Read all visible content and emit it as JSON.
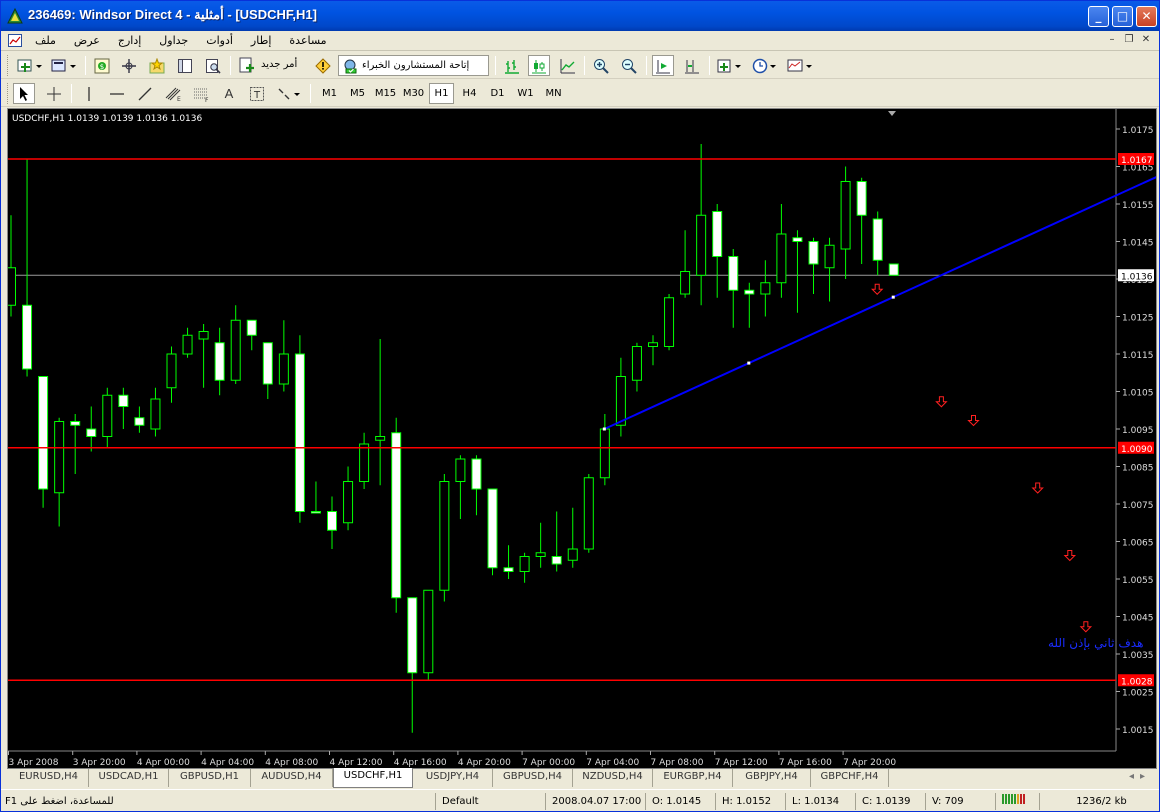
{
  "window": {
    "title": "236469: Windsor Direct 4 - أمثلية - [USDCHF,H1]"
  },
  "menu": [
    "ملف",
    "عرض",
    "إدارج",
    "جداول",
    "أدوات",
    "إطار",
    "مساعدة"
  ],
  "toolbar": {
    "new_order_label": "أمر جديد",
    "experts_label": "إتاحة المستشارون الخبراء",
    "timeframes": [
      "M1",
      "M5",
      "M15",
      "M30",
      "H1",
      "H4",
      "D1",
      "W1",
      "MN"
    ],
    "active_timeframe": "H1"
  },
  "chart": {
    "info": "USDCHF,H1  1.0139 1.0139 1.0136 1.0136",
    "annotation": "هدف ثاني بإذن الله",
    "colors": {
      "bull": "#00ff00",
      "bear": "#00ff00",
      "body_bull": "#000000",
      "body_bear": "#ffffff",
      "level": "#ff0000",
      "trend": "#0000ff",
      "grid": "#888888"
    }
  },
  "chart_data": {
    "type": "candlestick",
    "symbol": "USDCHF",
    "timeframe": "H1",
    "ylim": [
      1.001,
      1.018
    ],
    "y_ticks": [
      1.0175,
      1.0165,
      1.0155,
      1.0145,
      1.0135,
      1.0125,
      1.0115,
      1.0105,
      1.0095,
      1.0085,
      1.0075,
      1.0065,
      1.0055,
      1.0045,
      1.0035,
      1.0025,
      1.0015
    ],
    "x_ticks": [
      {
        "label": "3 Apr 2008",
        "index": 0
      },
      {
        "label": "3 Apr 20:00",
        "index": 4
      },
      {
        "label": "4 Apr 00:00",
        "index": 8
      },
      {
        "label": "4 Apr 04:00",
        "index": 12
      },
      {
        "label": "4 Apr 08:00",
        "index": 16
      },
      {
        "label": "4 Apr 12:00",
        "index": 20
      },
      {
        "label": "4 Apr 16:00",
        "index": 24
      },
      {
        "label": "4 Apr 20:00",
        "index": 28
      },
      {
        "label": "7 Apr 00:00",
        "index": 32
      },
      {
        "label": "7 Apr 04:00",
        "index": 36
      },
      {
        "label": "7 Apr 08:00",
        "index": 40
      },
      {
        "label": "7 Apr 12:00",
        "index": 44
      },
      {
        "label": "7 Apr 16:00",
        "index": 48
      },
      {
        "label": "7 Apr 20:00",
        "index": 52
      }
    ],
    "candles": [
      {
        "o": 1.0128,
        "h": 1.0152,
        "l": 1.0125,
        "c": 1.0138
      },
      {
        "o": 1.0128,
        "h": 1.0167,
        "l": 1.0109,
        "c": 1.0111
      },
      {
        "o": 1.0109,
        "h": 1.0109,
        "l": 1.0074,
        "c": 1.0079
      },
      {
        "o": 1.0078,
        "h": 1.0098,
        "l": 1.0069,
        "c": 1.0097
      },
      {
        "o": 1.0097,
        "h": 1.0099,
        "l": 1.0083,
        "c": 1.0096
      },
      {
        "o": 1.0095,
        "h": 1.0101,
        "l": 1.0089,
        "c": 1.0093
      },
      {
        "o": 1.0093,
        "h": 1.0106,
        "l": 1.009,
        "c": 1.0104
      },
      {
        "o": 1.0104,
        "h": 1.0106,
        "l": 1.0095,
        "c": 1.0101
      },
      {
        "o": 1.0098,
        "h": 1.0101,
        "l": 1.0094,
        "c": 1.0096
      },
      {
        "o": 1.0095,
        "h": 1.0106,
        "l": 1.0093,
        "c": 1.0103
      },
      {
        "o": 1.0106,
        "h": 1.0117,
        "l": 1.0102,
        "c": 1.0115
      },
      {
        "o": 1.0115,
        "h": 1.0122,
        "l": 1.0114,
        "c": 1.012
      },
      {
        "o": 1.0119,
        "h": 1.0123,
        "l": 1.0106,
        "c": 1.0121
      },
      {
        "o": 1.0118,
        "h": 1.0122,
        "l": 1.0104,
        "c": 1.0108
      },
      {
        "o": 1.0108,
        "h": 1.0128,
        "l": 1.0107,
        "c": 1.0124
      },
      {
        "o": 1.0124,
        "h": 1.0124,
        "l": 1.0116,
        "c": 1.012
      },
      {
        "o": 1.0118,
        "h": 1.0118,
        "l": 1.0103,
        "c": 1.0107
      },
      {
        "o": 1.0107,
        "h": 1.0124,
        "l": 1.0105,
        "c": 1.0115
      },
      {
        "o": 1.0115,
        "h": 1.012,
        "l": 1.007,
        "c": 1.0073
      },
      {
        "o": 1.0073,
        "h": 1.0081,
        "l": 1.0073,
        "c": 1.0073
      },
      {
        "o": 1.0073,
        "h": 1.0077,
        "l": 1.0063,
        "c": 1.0068
      },
      {
        "o": 1.007,
        "h": 1.0085,
        "l": 1.0068,
        "c": 1.0081
      },
      {
        "o": 1.0081,
        "h": 1.0094,
        "l": 1.0079,
        "c": 1.0091
      },
      {
        "o": 1.0092,
        "h": 1.0119,
        "l": 1.008,
        "c": 1.0093
      },
      {
        "o": 1.0094,
        "h": 1.0098,
        "l": 1.0046,
        "c": 1.005
      },
      {
        "o": 1.005,
        "h": 1.005,
        "l": 1.0014,
        "c": 1.003
      },
      {
        "o": 1.003,
        "h": 1.0052,
        "l": 1.0028,
        "c": 1.0052
      },
      {
        "o": 1.0052,
        "h": 1.0083,
        "l": 1.0049,
        "c": 1.0081
      },
      {
        "o": 1.0081,
        "h": 1.0088,
        "l": 1.0071,
        "c": 1.0087
      },
      {
        "o": 1.0087,
        "h": 1.0088,
        "l": 1.0072,
        "c": 1.0079
      },
      {
        "o": 1.0079,
        "h": 1.0079,
        "l": 1.0056,
        "c": 1.0058
      },
      {
        "o": 1.0058,
        "h": 1.0064,
        "l": 1.0055,
        "c": 1.0057
      },
      {
        "o": 1.0057,
        "h": 1.0062,
        "l": 1.0054,
        "c": 1.0061
      },
      {
        "o": 1.0061,
        "h": 1.007,
        "l": 1.0058,
        "c": 1.0062
      },
      {
        "o": 1.0061,
        "h": 1.0073,
        "l": 1.0057,
        "c": 1.0059
      },
      {
        "o": 1.006,
        "h": 1.0074,
        "l": 1.0058,
        "c": 1.0063
      },
      {
        "o": 1.0063,
        "h": 1.0083,
        "l": 1.0062,
        "c": 1.0082
      },
      {
        "o": 1.0082,
        "h": 1.0099,
        "l": 1.008,
        "c": 1.0095
      },
      {
        "o": 1.0096,
        "h": 1.0114,
        "l": 1.0093,
        "c": 1.0109
      },
      {
        "o": 1.0108,
        "h": 1.0118,
        "l": 1.0105,
        "c": 1.0117
      },
      {
        "o": 1.0117,
        "h": 1.012,
        "l": 1.0112,
        "c": 1.0118
      },
      {
        "o": 1.0117,
        "h": 1.0131,
        "l": 1.0116,
        "c": 1.013
      },
      {
        "o": 1.0131,
        "h": 1.0148,
        "l": 1.013,
        "c": 1.0137
      },
      {
        "o": 1.0136,
        "h": 1.0171,
        "l": 1.0128,
        "c": 1.0152
      },
      {
        "o": 1.0153,
        "h": 1.0155,
        "l": 1.013,
        "c": 1.0141
      },
      {
        "o": 1.0141,
        "h": 1.0143,
        "l": 1.0122,
        "c": 1.0132
      },
      {
        "o": 1.0132,
        "h": 1.0134,
        "l": 1.0122,
        "c": 1.0131
      },
      {
        "o": 1.0131,
        "h": 1.014,
        "l": 1.0125,
        "c": 1.0134
      },
      {
        "o": 1.0134,
        "h": 1.0155,
        "l": 1.013,
        "c": 1.0147
      },
      {
        "o": 1.0146,
        "h": 1.0148,
        "l": 1.0126,
        "c": 1.0145
      },
      {
        "o": 1.0145,
        "h": 1.0146,
        "l": 1.0131,
        "c": 1.0139
      },
      {
        "o": 1.0138,
        "h": 1.0146,
        "l": 1.0129,
        "c": 1.0144
      },
      {
        "o": 1.0143,
        "h": 1.0165,
        "l": 1.0135,
        "c": 1.0161
      },
      {
        "o": 1.0161,
        "h": 1.0162,
        "l": 1.0139,
        "c": 1.0152
      },
      {
        "o": 1.0151,
        "h": 1.0153,
        "l": 1.0136,
        "c": 1.014
      },
      {
        "o": 1.0139,
        "h": 1.0139,
        "l": 1.0136,
        "c": 1.0136
      }
    ],
    "hlines": [
      {
        "price": 1.0167,
        "label": "1.0167",
        "color": "#ff0000"
      },
      {
        "price": 1.009,
        "label": "1.0090",
        "color": "#ff0000"
      },
      {
        "price": 1.0028,
        "label": "1.0028",
        "color": "#ff0000"
      }
    ],
    "bid_line": {
      "price": 1.0136,
      "label": "1.0136"
    },
    "trendline": {
      "from": {
        "index": 37,
        "price": 1.0095
      },
      "to": {
        "index": 80,
        "price": 1.0179
      }
    },
    "target_arrows": [
      {
        "index": 54,
        "price": 1.0132
      },
      {
        "index": 58,
        "price": 1.0102
      },
      {
        "index": 60,
        "price": 1.0097
      },
      {
        "index": 64,
        "price": 1.0079
      },
      {
        "index": 66,
        "price": 1.0061
      },
      {
        "index": 67,
        "price": 1.0042
      }
    ]
  },
  "tabs": {
    "items": [
      "EURUSD,H4",
      "USDCAD,H1",
      "GBPUSD,H1",
      "AUDUSD,H4",
      "USDCHF,H1",
      "USDJPY,H4",
      "GBPUSD,H4",
      "NZDUSD,H4",
      "EURGBP,H4",
      "GBPJPY,H4",
      "GBPCHF,H4"
    ],
    "active": "USDCHF,H1"
  },
  "status": {
    "help": "للمساعدة، اضغط على F1",
    "profile": "Default",
    "datetime": "2008.04.07 17:00",
    "open": "O: 1.0145",
    "high": "H: 1.0152",
    "low": "L: 1.0134",
    "close": "C: 1.0139",
    "volume": "V: 709",
    "traffic": "1236/2 kb"
  }
}
